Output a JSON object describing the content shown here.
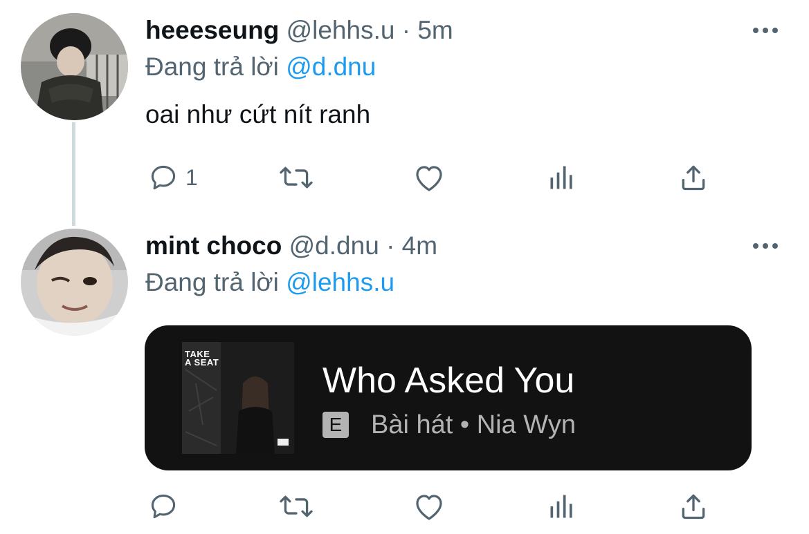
{
  "tweets": [
    {
      "name": "heeeseung",
      "handle": "@lehhs.u",
      "separator": "·",
      "time": "5m",
      "reply_prefix": "Đang trả lời",
      "reply_to": "@d.dnu",
      "text": "oai như cứt nít ranh",
      "reply_count": "1",
      "icons": [
        "reply-icon",
        "retweet-icon",
        "like-icon",
        "analytics-icon",
        "share-icon",
        "more-icon"
      ]
    },
    {
      "name": "mint choco",
      "handle": "@d.dnu",
      "separator": "·",
      "time": "4m",
      "reply_prefix": "Đang trả lời",
      "reply_to": "@lehhs.u",
      "reply_count": "",
      "icons": [
        "reply-icon",
        "retweet-icon",
        "like-icon",
        "analytics-icon",
        "share-icon",
        "more-icon"
      ]
    }
  ],
  "song_card": {
    "cover_text_line1": "TAKE",
    "cover_text_line2": "A SEAT",
    "title": "Who Asked You",
    "explicit_badge": "E",
    "meta": "Bài hát • Nia Wyn"
  },
  "colors": {
    "link": "#1d9bf0",
    "secondary_text": "#536471",
    "card_bg": "#121212",
    "thread_line": "#cfd9de"
  }
}
